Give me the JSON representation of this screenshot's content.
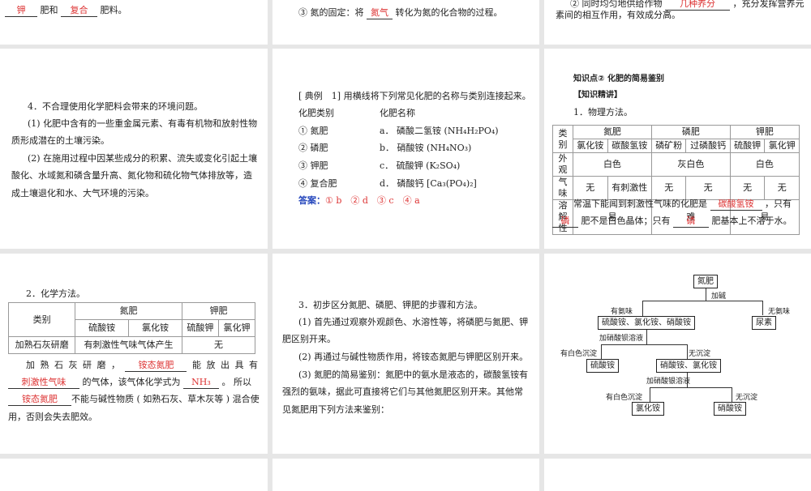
{
  "slides": {
    "s1": {
      "blank1": "钾",
      "mid": "肥和",
      "blank2": "复合",
      "end": "肥料。"
    },
    "s2": {
      "pre": "③ 氮的固定：将",
      "blank": "氮气",
      "post": "转化为氮的化合物的过程。"
    },
    "s3": {
      "pre": "② 同时均匀地供给作物",
      "blank": "几种养分",
      "post": "，充分发挥营养元",
      "line2": "素间的相互作用，有效成分高。"
    },
    "s4": {
      "lines": [
        "4．不合理使用化学肥料会带来的环境问题。",
        "(1) 化肥中含有的一些重金属元素、有毒有机物和放射性物",
        "质形成潜在的土壤污染。",
        "(2) 在施用过程中因某些成分的积累、流失或变化引起土壤",
        "酸化、水域氮和磷含量升高、氮化物和硫化物气体排放等，造",
        "成土壤退化和水、大气环境的污染。"
      ]
    },
    "s5": {
      "title": "[ 典例　1] 用横线将下列常见化肥的名称与类别连接起来。",
      "col1": "化肥类别",
      "col2": "化肥名称",
      "left": [
        "① 氮肥",
        "② 磷肥",
        "③ 钾肥",
        "④ 复合肥"
      ],
      "right": [
        "a． 磷酸二氢铵 (NH₄H₂PO₄)",
        "b． 硝酸铵 (NH₄NO₃)",
        "c． 硫酸钾 (K₂SO₄)",
        "d． 磷酸钙 [Ca₃(PO₄)₂]"
      ],
      "answer_label": "答案：",
      "answer": "① b　② d　③ c　④ a"
    },
    "s6": {
      "heading": "知识点② 化肥的简易鉴别",
      "sub": "【知识精讲】",
      "item": "1．物理方法。",
      "table": {
        "h": "类别",
        "groups": [
          "氮肥",
          "磷肥",
          "钾肥"
        ],
        "subs": [
          "氯化铵",
          "碳酸氢铵",
          "磷矿粉",
          "过磷酸钙",
          "硫酸钾",
          "氯化钾"
        ],
        "rows": [
          {
            "k": "外观",
            "v": [
              "白色",
              "灰白色",
              "白色"
            ]
          },
          {
            "k": "气味",
            "v": [
              "无",
              "有刺激性",
              "无",
              "无",
              "无",
              "无"
            ]
          },
          {
            "k": "溶解性",
            "v": [
              "易",
              "难",
              "易"
            ]
          }
        ]
      },
      "p1": "常温下能闻到刺激性气味的化肥是",
      "b1": "碳酸氢铵",
      "p2": "，只有",
      "b2": "磷",
      "p3": "肥不是白色晶体；只有",
      "b3": "磷",
      "p4": "肥基本上不溶于水。"
    },
    "s7": {
      "item": "2．化学方法。",
      "table": {
        "h": "类别",
        "g1": "氮肥",
        "g2": "钾肥",
        "subs": [
          "硫酸铵",
          "氯化铵",
          "硫酸钾",
          "氯化钾"
        ],
        "rk": "加熟石灰研磨",
        "r1": "有刺激性气味气体产生",
        "r2": "无"
      },
      "t1": "加 熟 石 灰 研 磨 ，",
      "b1": "铵态氮肥",
      "t2": "能 放 出 具 有",
      "b2": "刺激性气味",
      "t3": "的气体，该气体化学式为",
      "b3": "NH₃",
      "t4": "。 所以",
      "b4": "铵态氮肥",
      "t5": "不能与碱性物质 ( 如熟石灰、草木灰等 ) 混合使",
      "t6": "用，否则会失去肥效。"
    },
    "s8": {
      "lines": [
        "3．初步区分氮肥、磷肥、钾肥的步骤和方法。",
        "(1) 首先通过观察外观颜色、水溶性等，将磷肥与氮肥、钾",
        "肥区别开来。",
        "(2) 再通过与碱性物质作用，将铵态氮肥与钾肥区别开来。",
        "(3) 氮肥的简易鉴别：氮肥中的氨水是液态的，碳酸氢铵有",
        "强烈的氨味，据此可直接将它们与其他氮肥区别开来。其他常",
        "见氮肥用下列方法来鉴别："
      ]
    },
    "s9": {
      "root": "氮肥",
      "add_base": "加碱",
      "ammonia": "有氨味",
      "no_ammonia": "无氨味",
      "group1": "硫酸铵、氯化铵、硝酸铵",
      "urea": "尿素",
      "add_ba": "加硝酸钡溶液",
      "white1": "有白色沉淀",
      "none1": "无沉淀",
      "sulfate": "硫酸铵",
      "group2": "硝酸铵、氯化铵",
      "add_ag": "加硝酸银溶液",
      "white2": "有白色沉淀",
      "none2": "无沉淀",
      "chloride": "氯化铵",
      "nitrate": "硝酸铵"
    }
  }
}
